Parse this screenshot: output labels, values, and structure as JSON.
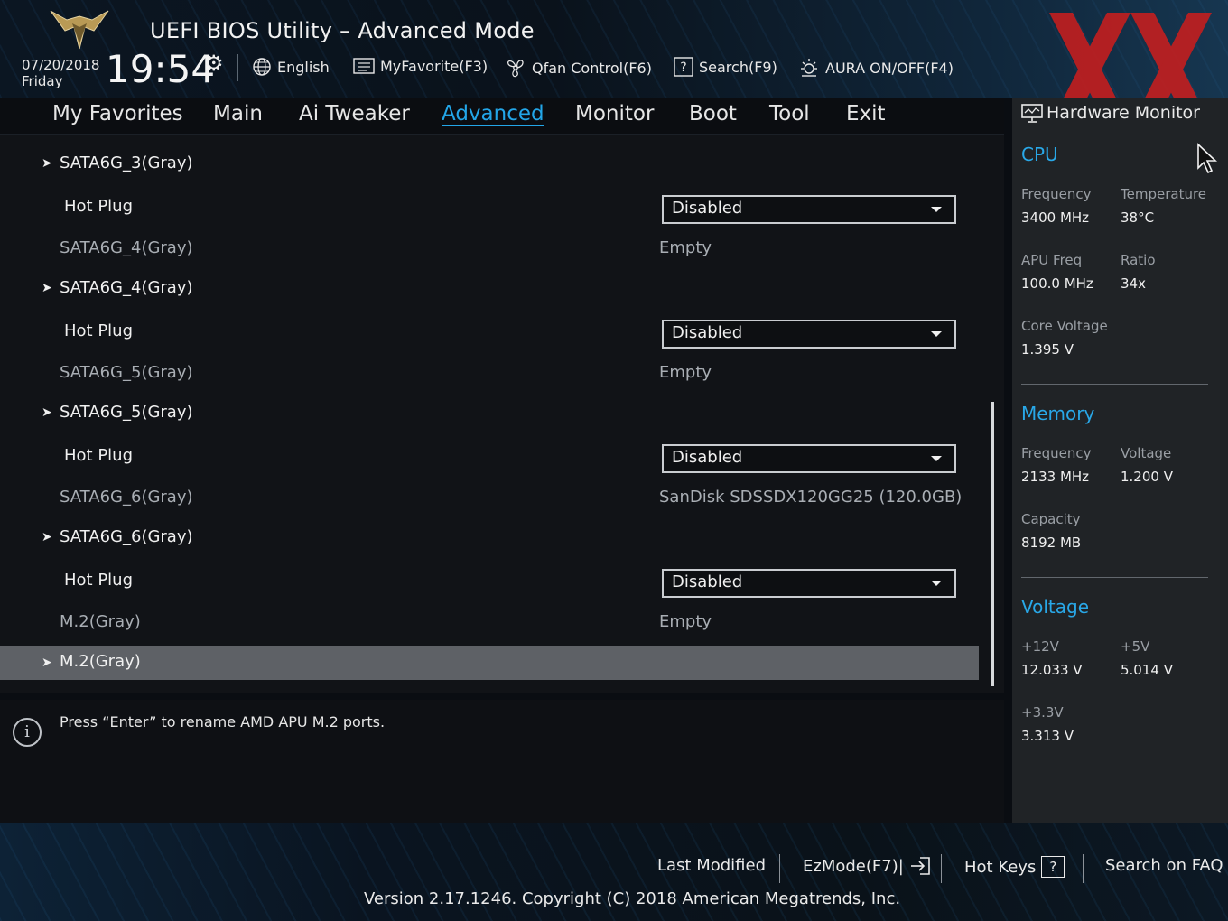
{
  "header": {
    "title": "UEFI BIOS Utility – Advanced Mode",
    "date": "07/20/2018",
    "day": "Friday",
    "time": "19:54",
    "tools": {
      "language": "English",
      "myfavorite": "MyFavorite(F3)",
      "qfan": "Qfan Control(F6)",
      "search": "Search(F9)",
      "aura": "AURA ON/OFF(F4)"
    }
  },
  "tabs": {
    "favorites": "My Favorites",
    "main": "Main",
    "ai_tweaker": "Ai Tweaker",
    "advanced": "Advanced",
    "monitor": "Monitor",
    "boot": "Boot",
    "tool": "Tool",
    "exit": "Exit",
    "active": "Advanced"
  },
  "rows": {
    "sata3_group": "SATA6G_3(Gray)",
    "sata3_hotplug_label": "Hot Plug",
    "sata3_hotplug_value": "Disabled",
    "sata4_label": "SATA6G_4(Gray)",
    "sata4_value": "Empty",
    "sata4_group": "SATA6G_4(Gray)",
    "sata4_hotplug_label": "Hot Plug",
    "sata4_hotplug_value": "Disabled",
    "sata5_label": "SATA6G_5(Gray)",
    "sata5_value": "Empty",
    "sata5_group": "SATA6G_5(Gray)",
    "sata5_hotplug_label": "Hot Plug",
    "sata5_hotplug_value": "Disabled",
    "sata6_label": "SATA6G_6(Gray)",
    "sata6_value": "SanDisk SDSSDX120GG25 (120.0GB)",
    "sata6_group": "SATA6G_6(Gray)",
    "sata6_hotplug_label": "Hot Plug",
    "sata6_hotplug_value": "Disabled",
    "m2_label": "M.2(Gray)",
    "m2_value": "Empty",
    "m2_group": "M.2(Gray)"
  },
  "help": {
    "text": "Press “Enter” to rename AMD APU M.2 ports."
  },
  "hardware_monitor": {
    "title": "Hardware Monitor",
    "cpu": {
      "heading": "CPU",
      "frequency_label": "Frequency",
      "frequency": "3400 MHz",
      "temperature_label": "Temperature",
      "temperature": "38°C",
      "apu_freq_label": "APU Freq",
      "apu_freq": "100.0 MHz",
      "ratio_label": "Ratio",
      "ratio": "34x",
      "core_voltage_label": "Core Voltage",
      "core_voltage": "1.395 V"
    },
    "memory": {
      "heading": "Memory",
      "frequency_label": "Frequency",
      "frequency": "2133 MHz",
      "voltage_label": "Voltage",
      "voltage": "1.200 V",
      "capacity_label": "Capacity",
      "capacity": "8192 MB"
    },
    "voltage": {
      "heading": "Voltage",
      "v12_label": "+12V",
      "v12": "12.033 V",
      "v5_label": "+5V",
      "v5": "5.014 V",
      "v33_label": "+3.3V",
      "v33": "3.313 V"
    }
  },
  "footer": {
    "last_modified": "Last Modified",
    "ezmode": "EzMode(F7)|",
    "hotkeys": "Hot Keys",
    "hotkeys_key": "?",
    "faq": "Search on FAQ",
    "version": "Version 2.17.1246. Copyright (C) 2018 American Megatrends, Inc."
  },
  "colors": {
    "accent": "#23a6e8",
    "selected_row": "#5e6166",
    "watermark": "#c81e1e"
  },
  "icons": [
    "tuf-logo",
    "gear-icon",
    "globe-icon",
    "favorite-list-icon",
    "fan-icon",
    "search-help-icon",
    "aura-light-icon",
    "monitor-icon",
    "info-icon",
    "ezmode-exit-icon",
    "cursor-icon"
  ]
}
